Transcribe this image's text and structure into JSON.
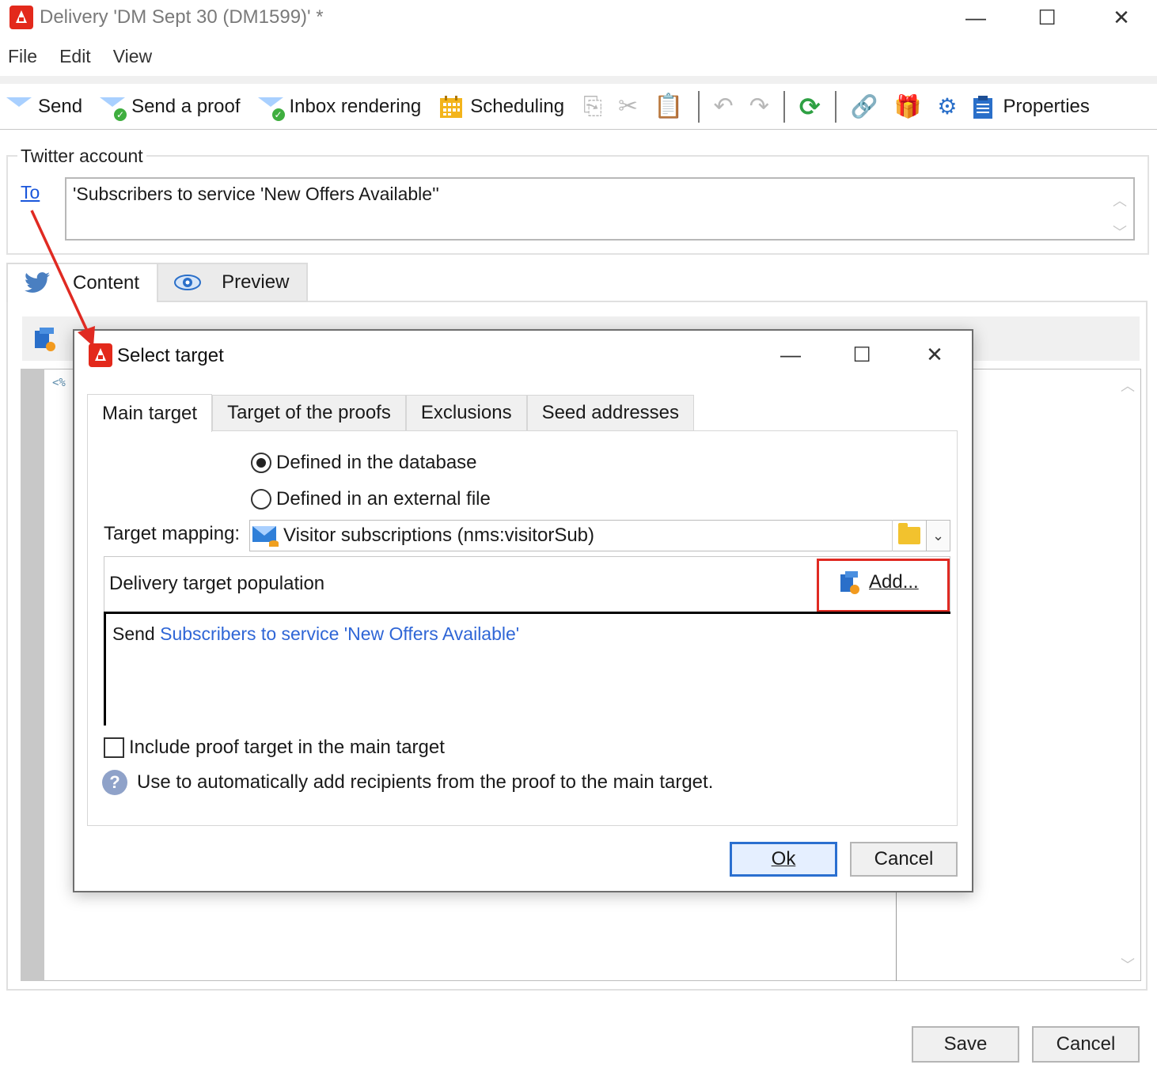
{
  "window": {
    "title": "Delivery 'DM Sept 30 (DM1599)' *"
  },
  "menu": [
    "File",
    "Edit",
    "View"
  ],
  "toolbar": {
    "send": "Send",
    "send_proof": "Send a proof",
    "inbox_rendering": "Inbox rendering",
    "scheduling": "Scheduling",
    "properties": "Properties"
  },
  "twitter": {
    "legend": "Twitter account",
    "to_label": "To",
    "to_value": "'Subscribers to service 'New Offers Available''"
  },
  "content_tabs": {
    "content": "Content",
    "preview": "Preview"
  },
  "footer": {
    "save": "Save",
    "cancel": "Cancel"
  },
  "dialog": {
    "title": "Select target",
    "tabs": [
      "Main target",
      "Target of the proofs",
      "Exclusions",
      "Seed addresses"
    ],
    "radio_database": "Defined in the database",
    "radio_external": "Defined in an external file",
    "mapping_label": "Target mapping:",
    "mapping_value": "Visitor subscriptions (nms:visitorSub)",
    "population_label": "Delivery target population",
    "add_label": "Add...",
    "population_send": "Send",
    "population_link": "Subscribers to service 'New Offers Available'",
    "include_proof": "Include proof target in the main target",
    "help_text": "Use to automatically add recipients from the proof to the main target.",
    "ok": "Ok",
    "cancel": "Cancel"
  },
  "colors": {
    "accent_red": "#e02a22",
    "link_blue": "#2f66d6",
    "brand_red": "#e3291b"
  }
}
